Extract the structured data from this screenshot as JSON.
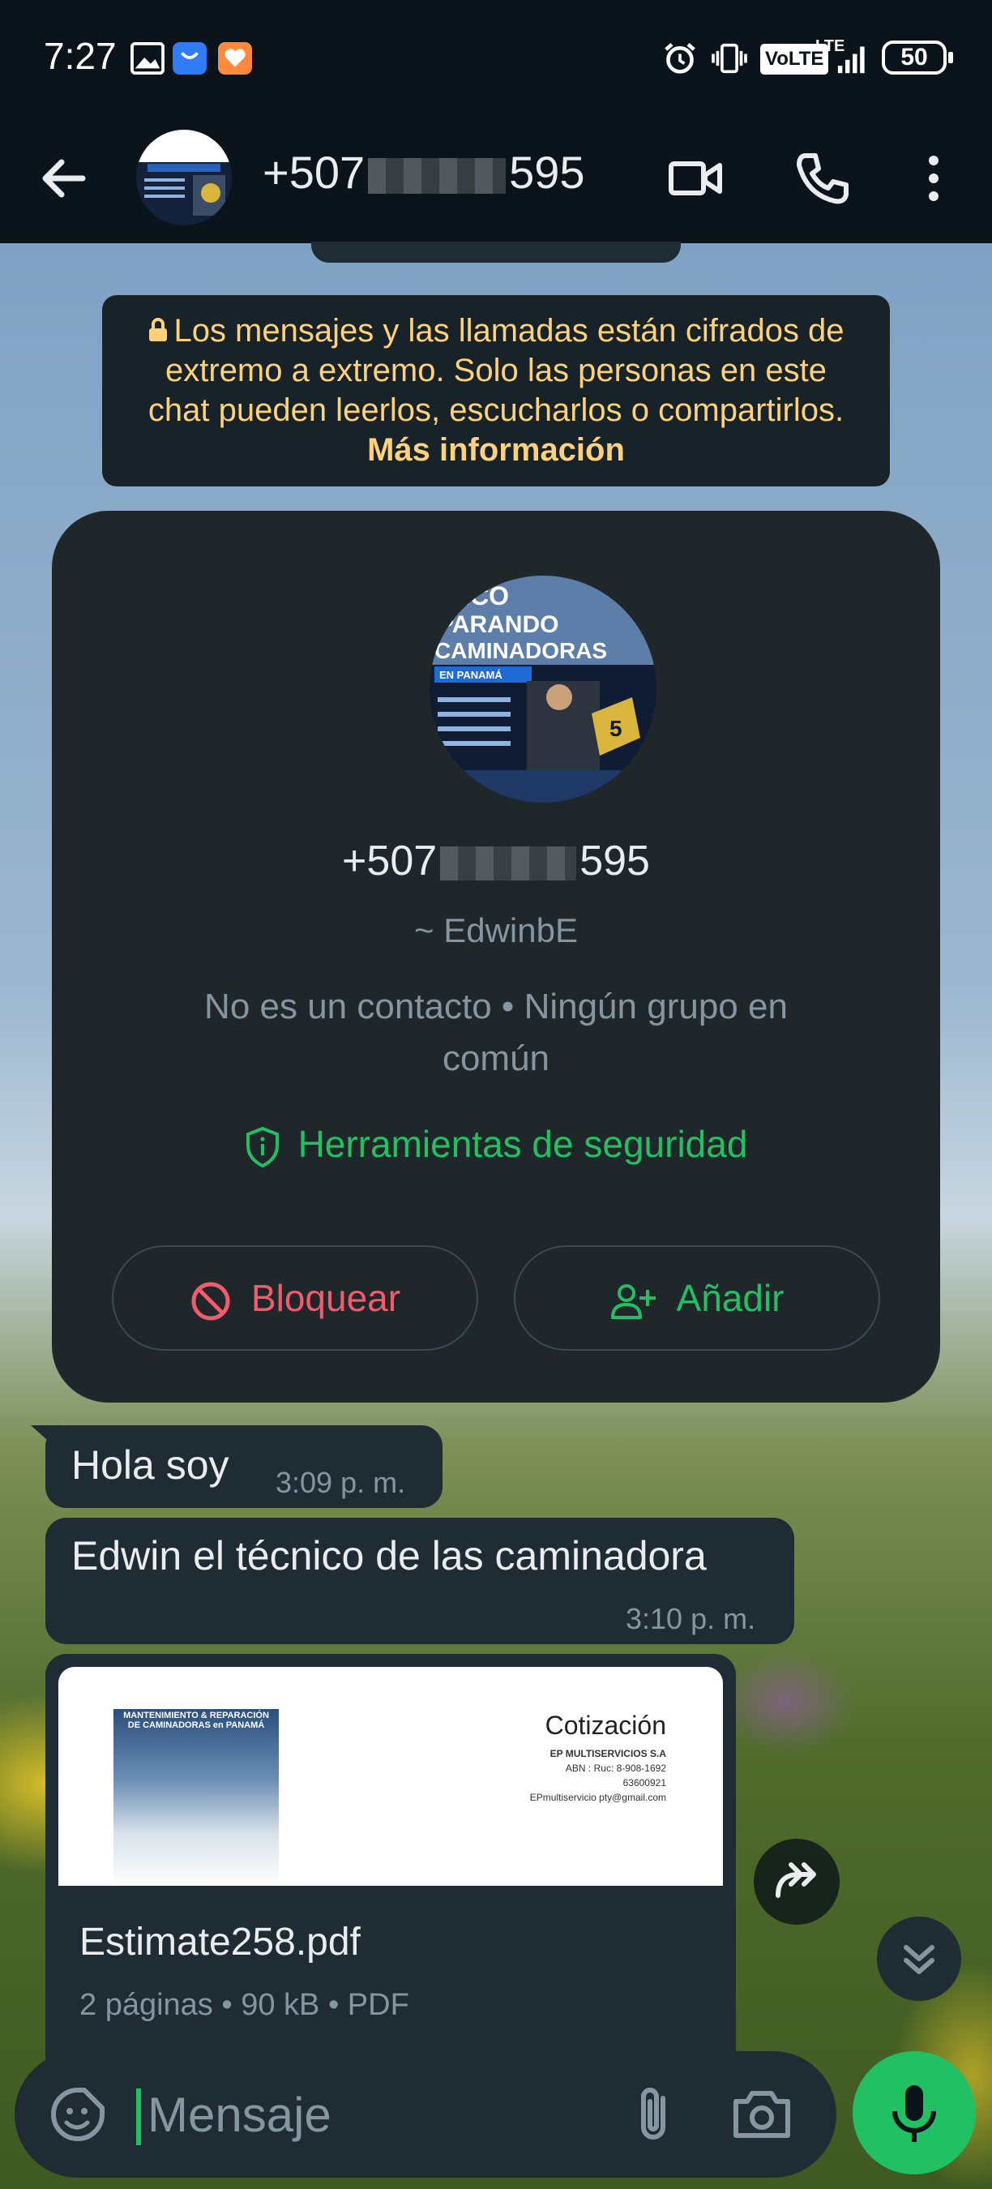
{
  "status_bar": {
    "time": "7:27",
    "battery": "50",
    "network": "LTE",
    "volte": "VoLTE"
  },
  "header": {
    "contact_prefix": "+507",
    "contact_suffix": "595",
    "icons": [
      "back-arrow-icon",
      "video-call-icon",
      "phone-icon",
      "more-vert-icon"
    ]
  },
  "encryption_notice": {
    "text": "Los mensajes y las llamadas están cifrados de extremo a extremo. Solo las personas en este chat pueden leerlos, escucharlos o compartirlos.",
    "link": "Más información"
  },
  "profile_card": {
    "phone_prefix": "+507",
    "phone_suffix": "595",
    "alias": "~ EdwinbE",
    "info": "No es un contacto • Ningún grupo en común",
    "security_label": "Herramientas de seguridad",
    "block_label": "Bloquear",
    "add_label": "Añadir",
    "avatar_text": [
      "NICO",
      "PARANDO",
      "CAMINADORAS",
      "EN PANAMÁ",
      "5"
    ]
  },
  "messages": [
    {
      "text": "Hola soy",
      "time": "3:09 p. m."
    },
    {
      "text": "Edwin el técnico de las caminadora",
      "time": "3:10 p. m."
    }
  ],
  "document": {
    "preview_title": "Cotización",
    "preview_company": "EP MULTISERVICIOS S.A",
    "preview_ruc": "ABN : Ruc: 8-908-1692",
    "preview_phone": "63600921",
    "preview_email": "EPmultiservicio pty@gmail.com",
    "preview_thumb_title": "MANTENIMIENTO & REPARACIÓN DE CAMINADORAS en PANAMÁ",
    "filename": "Estimate258.pdf",
    "meta": "2 páginas • 90 kB • PDF"
  },
  "composer": {
    "placeholder": "Mensaje"
  },
  "colors": {
    "accent": "#21c063",
    "danger": "#f15c6d",
    "notice_text": "#ffd279",
    "bubble": "#1f2c34",
    "header": "#0b141a"
  }
}
